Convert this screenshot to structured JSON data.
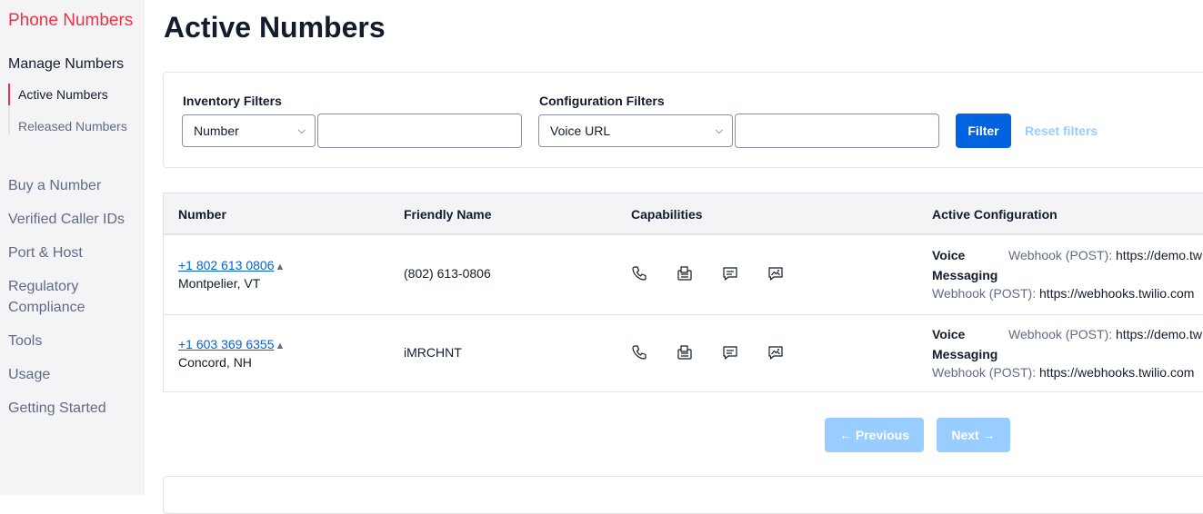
{
  "sidebar": {
    "brand": "Phone Numbers",
    "section_title": "Manage Numbers",
    "sub_items": [
      "Active Numbers",
      "Released Numbers"
    ],
    "nav": [
      "Buy a Number",
      "Verified Caller IDs",
      "Port & Host",
      "Regulatory Compliance",
      "Tools",
      "Usage",
      "Getting Started"
    ]
  },
  "page": {
    "title": "Active Numbers"
  },
  "filters": {
    "inventory_label": "Inventory Filters",
    "inventory_select": "Number",
    "inventory_value": "",
    "config_label": "Configuration Filters",
    "config_select": "Voice URL",
    "config_value": "",
    "filter_button": "Filter",
    "reset_link": "Reset filters"
  },
  "table": {
    "headers": [
      "Number",
      "Friendly Name",
      "Capabilities",
      "Active Configuration"
    ],
    "rows": [
      {
        "number": "+1 802 613 0806",
        "location": "Montpelier, VT",
        "friendly_name": "(802) 613-0806",
        "voice_label": "Voice",
        "voice_key": "Webhook (POST):",
        "voice_url": "https://demo.tw",
        "messaging_label": "Messaging",
        "messaging_key": "Webhook (POST):",
        "messaging_url": "https://webhooks.twilio.com"
      },
      {
        "number": "+1 603 369 6355",
        "location": "Concord, NH",
        "friendly_name": "iMRCHNT",
        "voice_label": "Voice",
        "voice_key": "Webhook (POST):",
        "voice_url": "https://demo.tw",
        "messaging_label": "Messaging",
        "messaging_key": "Webhook (POST):",
        "messaging_url": "https://webhooks.twilio.com"
      }
    ]
  },
  "pagination": {
    "previous": "← Previous",
    "next": "Next →"
  },
  "icons": {
    "number_sort": "triangle-up-icon",
    "capabilities": [
      "phone-icon",
      "fax-icon",
      "sms-icon",
      "mms-icon"
    ]
  },
  "colors": {
    "brand": "#f22f46",
    "primary": "#0263e0",
    "disabled": "#99cdff"
  }
}
